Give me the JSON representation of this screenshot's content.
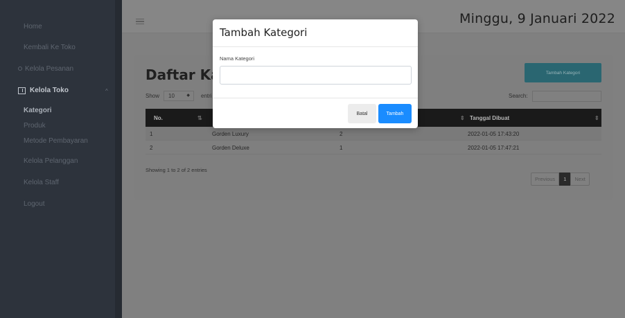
{
  "sidebar": {
    "items": [
      {
        "label": "Home"
      },
      {
        "label": "Kembali Ke Toko"
      },
      {
        "label": "Kelola Pesanan"
      },
      {
        "label": "Kelola Toko"
      },
      {
        "label": "Kategori"
      },
      {
        "label": "Produk"
      },
      {
        "label": "Metode Pembayaran"
      },
      {
        "label": "Kelola Pelanggan"
      },
      {
        "label": "Kelola Staff"
      },
      {
        "label": "Logout"
      }
    ],
    "section_chevron": "^"
  },
  "topbar": {
    "date": "Minggu, 9 Januari 2022",
    "menu_icon": "hamburger-icon"
  },
  "main": {
    "title": "Daftar Kat",
    "add_button_label": "Tambah Kategori",
    "show_label": "Show",
    "show_value": "10",
    "entries_label": "entri",
    "search_label": "Search:",
    "columns": [
      "No.",
      "Tanggal Dibuat"
    ],
    "rows": [
      {
        "no": "1",
        "name": "Gorden Luxury",
        "count": "2",
        "date": "2022-01-05 17:43:20"
      },
      {
        "no": "2",
        "name": "Gorden Deluxe",
        "count": "1",
        "date": "2022-01-05 17:47:21"
      }
    ],
    "showing_text": "Showing 1 to 2 of 2 entries",
    "pagination": {
      "previous": "Previous",
      "current": "1",
      "next": "Next"
    }
  },
  "modal": {
    "title": "Tambah Kategori",
    "field_label": "Nama Kategori",
    "field_value": "",
    "cancel_label": "Batal",
    "submit_label": "Tambah"
  },
  "colors": {
    "sidebar_bg": "#2d333c",
    "overlay_bg": "#808080",
    "primary": "#1a8cff",
    "accent_button": "#2a6671"
  }
}
